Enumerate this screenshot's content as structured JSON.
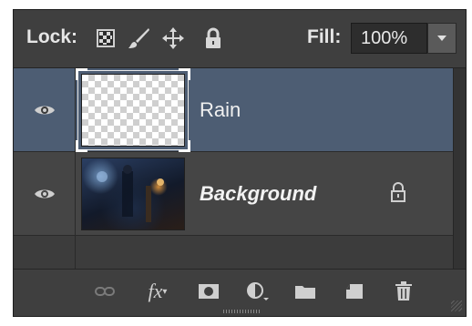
{
  "lockbar": {
    "lock_label": "Lock:",
    "lock_icons": [
      "lock-transparent-pixels-icon",
      "lock-image-pixels-icon",
      "lock-position-icon",
      "lock-all-icon"
    ],
    "fill_label": "Fill:",
    "fill_value": "100%"
  },
  "layers": [
    {
      "name": "Rain",
      "visible": true,
      "selected": true,
      "locked": false
    },
    {
      "name": "Background",
      "visible": true,
      "selected": false,
      "locked": true
    }
  ],
  "footer": {
    "buttons": [
      "link-layers-icon",
      "fx-icon",
      "add-mask-icon",
      "adjustment-layer-icon",
      "new-group-icon",
      "new-layer-icon",
      "delete-layer-icon"
    ],
    "fx_label": "fx"
  },
  "colors": {
    "panel_bg": "#3a3a3a",
    "selected_row": "#4d5d73",
    "text": "#f0f0f0"
  }
}
